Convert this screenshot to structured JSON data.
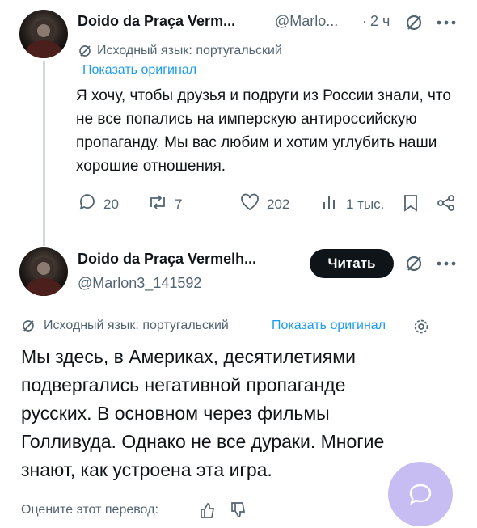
{
  "tweet1": {
    "author_name": "Doido da Praça Verm...",
    "handle": "@Marlo...",
    "sep": "·",
    "time": "2 ч",
    "translation_note": "Исходный язык: португальский",
    "show_original": "Показать оригинал",
    "text": "Я хочу, чтобы друзья и подруги из России знали, что не все попались на имперскую антироссийскую пропаганду. Мы вас любим и хотим углубить наши хорошие отношения.",
    "stats": {
      "replies": "20",
      "reposts": "7",
      "likes": "202",
      "views": "1 тыс."
    }
  },
  "tweet2": {
    "author_name": "Doido da Praça Vermelh...",
    "handle": "@Marlon3_141592",
    "follow_label": "Читать",
    "translation_note": "Исходный язык: португальский",
    "show_original": "Показать оригинал",
    "text": "Мы здесь, в Америках, десятилетиями подвергались негативной пропаганде русских. В основном через фильмы Голливуда. Однако не все дураки. Многие знают, как устроена эта игра.",
    "rate_translation": "Оцените этот перевод:"
  },
  "colors": {
    "accent": "#1d9bf0",
    "fab": "#c7bdf2",
    "text": "#0f1419",
    "secondary": "#536471"
  },
  "icons": [
    "grok-icon",
    "more-icon",
    "translate-icon",
    "reply-icon",
    "repost-icon",
    "like-icon",
    "views-icon",
    "bookmark-icon",
    "share-icon",
    "settings-icon",
    "thumbs-up-icon",
    "thumbs-down-icon",
    "chat-icon"
  ]
}
